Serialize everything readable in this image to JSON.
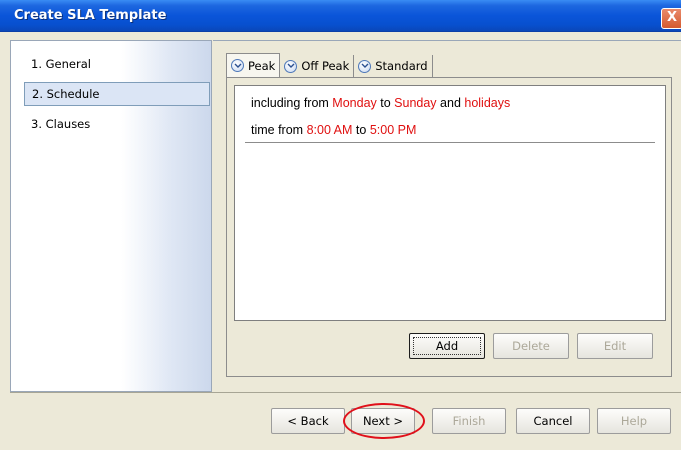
{
  "window": {
    "title": "Create SLA Template",
    "close_label": "X"
  },
  "steps": [
    {
      "label": "1. General",
      "selected": false
    },
    {
      "label": "2. Schedule",
      "selected": true
    },
    {
      "label": "3. Clauses",
      "selected": false
    }
  ],
  "tabs": [
    {
      "label": "Peak",
      "active": true,
      "icon": "chevron-down-icon"
    },
    {
      "label": "Off Peak",
      "active": false,
      "icon": "chevron-down-icon"
    },
    {
      "label": "Standard",
      "active": false,
      "icon": "chevron-down-icon"
    }
  ],
  "schedule": {
    "line1": {
      "prefix": "including from ",
      "start_day": "Monday",
      "to": " to ",
      "end_day": "Sunday",
      "and": " and ",
      "extra": "holidays"
    },
    "line2": {
      "prefix": "time from ",
      "start_time": "8:00 AM",
      "to": " to ",
      "end_time": "5:00 PM"
    },
    "highlight_color": "#e01010"
  },
  "content_buttons": {
    "add": "Add",
    "delete": "Delete",
    "edit": "Edit"
  },
  "nav_buttons": {
    "back": "< Back",
    "next": "Next >",
    "finish": "Finish",
    "cancel": "Cancel",
    "help": "Help"
  },
  "colors": {
    "title_bar": "#0a55d9",
    "annotation": "#e0101a"
  }
}
